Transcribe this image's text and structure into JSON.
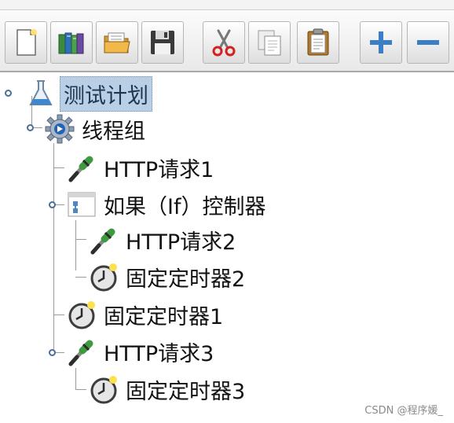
{
  "toolbar": {
    "buttons": [
      {
        "name": "new-button",
        "icon": "new-document-icon"
      },
      {
        "name": "templates-button",
        "icon": "books-icon"
      },
      {
        "name": "open-button",
        "icon": "folder-icon"
      },
      {
        "name": "save-button",
        "icon": "floppy-icon"
      },
      {
        "name": "cut-button",
        "icon": "scissors-icon"
      },
      {
        "name": "copy-button",
        "icon": "copy-icon"
      },
      {
        "name": "paste-button",
        "icon": "clipboard-icon"
      },
      {
        "name": "expand-button",
        "icon": "plus-icon"
      },
      {
        "name": "collapse-button",
        "icon": "minus-icon"
      }
    ]
  },
  "tree": {
    "test_plan": "测试计划",
    "thread_group": "线程组",
    "http_request_1": "HTTP请求1",
    "if_controller": "如果（If）控制器",
    "http_request_2": "HTTP请求2",
    "timer_2": "固定定时器2",
    "timer_1": "固定定时器1",
    "http_request_3": "HTTP请求3",
    "timer_3": "固定定时器3"
  },
  "watermark": "CSDN @程序媛_",
  "colors": {
    "selection": "#b8cfe5",
    "plus_minus": "#3b7fc7",
    "handle": "#4a6e9a"
  }
}
